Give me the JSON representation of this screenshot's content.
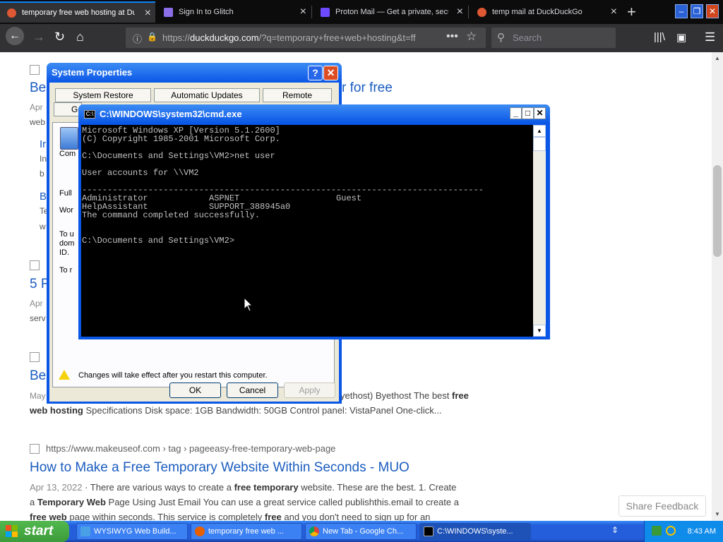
{
  "browser": {
    "tabs": [
      {
        "title": "temporary free web hosting at Duc",
        "active": true,
        "favicon_color": "#de5833"
      },
      {
        "title": "Sign In to Glitch",
        "active": false,
        "favicon_color": "#8c6fe8"
      },
      {
        "title": "Proton Mail — Get a private, secu",
        "active": false,
        "favicon_color": "#6d4aff"
      },
      {
        "title": "temp mail at DuckDuckGo",
        "active": false,
        "favicon_color": "#de5833"
      }
    ],
    "url_prefix": "https://",
    "url_domain": "duckduckgo.com",
    "url_rest": "/?q=temporary+free+web+hosting&t=ff",
    "search_placeholder": "Search"
  },
  "results": {
    "r1_title_tail": "r for free",
    "r1_title_head": "Be",
    "r1_date": "Apr",
    "r1_frag2": "web",
    "r1_sub1": "Ir",
    "r1_sub1b": "In",
    "r1_sub1c": "b",
    "r1_sub2": "B",
    "r1_sub2b": "Te",
    "r1_sub2c": "w",
    "r2_title_head": "5 F",
    "r2_date": "Apr",
    "r2_frag": "serv",
    "r3_title_head": "Be",
    "r3_date": "May",
    "r3_snip_line1": "yethost) Byethost The best",
    "r3_snip_line1_bold": "free",
    "r3_snip_line2_bold": "web hosting",
    "r3_snip_line2": " Specifications Disk space: 1GB Bandwidth: 50GB Control panel: VistaPanel One-click...",
    "r4_url": "https://www.makeuseof.com › tag › pageeasy-free-temporary-web-page",
    "r4_title": "How to Make a Free Temporary Website Within Seconds - MUO",
    "r4_date": "Apr 13, 2022",
    "r4_snip1a": "There are various ways to create a",
    "r4_snip1b": "free temporary",
    "r4_snip1c": "website. These are the best. 1. Create",
    "r4_snip2a": "a",
    "r4_snip2b": "Temporary Web",
    "r4_snip2c": "Page Using Just Email You can use a great service called publishthis.email to create a",
    "r4_snip3a": "free web",
    "r4_snip3b": "page within seconds. This service is completely",
    "r4_snip3c": "free",
    "r4_snip3d": "and you don't need to sign up for an",
    "share_feedback": "Share Feedback"
  },
  "sysprop": {
    "title": "System Properties",
    "tabs": [
      "System Restore",
      "Automatic Updates",
      "Remote"
    ],
    "tab2_partial": "Ge",
    "left_labels": [
      "Com",
      "Full",
      "Wor",
      "To u",
      "dom",
      "ID.",
      "To r"
    ],
    "notice": "Changes will take effect after you restart this computer.",
    "ok": "OK",
    "cancel": "Cancel",
    "apply": "Apply"
  },
  "cmd": {
    "title": "C:\\WINDOWS\\system32\\cmd.exe",
    "icon_text": "C:\\",
    "output": "Microsoft Windows XP [Version 5.1.2600]\n(C) Copyright 1985-2001 Microsoft Corp.\n\nC:\\Documents and Settings\\VM2>net user\n\nUser accounts for \\\\VM2\n\n-------------------------------------------------------------------------------\nAdministrator            ASPNET                   Guest\nHelpAssistant            SUPPORT_388945a0\nThe command completed successfully.\n\n\nC:\\Documents and Settings\\VM2>"
  },
  "taskbar": {
    "start": "start",
    "items": [
      {
        "label": "WYSIWYG Web Build...",
        "active": false
      },
      {
        "label": "temporary free web ...",
        "active": false
      },
      {
        "label": "New Tab - Google Ch...",
        "active": false
      },
      {
        "label": "C:\\WINDOWS\\syste...",
        "active": true
      }
    ],
    "clock": "8:43 AM"
  }
}
